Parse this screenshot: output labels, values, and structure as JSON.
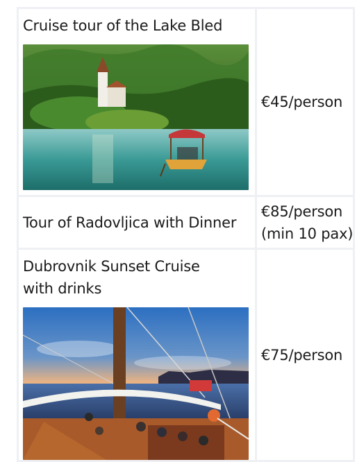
{
  "tours": [
    {
      "title": "Cruise tour of the Lake Bled",
      "price": "€45/person",
      "image": "lake-bled-boat-photo"
    },
    {
      "title": "Tour of Radovljica with Dinner",
      "price_line1": "€85/person",
      "price_line2": "(min 10 pax)"
    },
    {
      "title_line1": "Dubrovnik Sunset Cruise",
      "title_line2": "with drinks",
      "price": "€75/person",
      "image": "sunset-sailboat-photo"
    }
  ]
}
